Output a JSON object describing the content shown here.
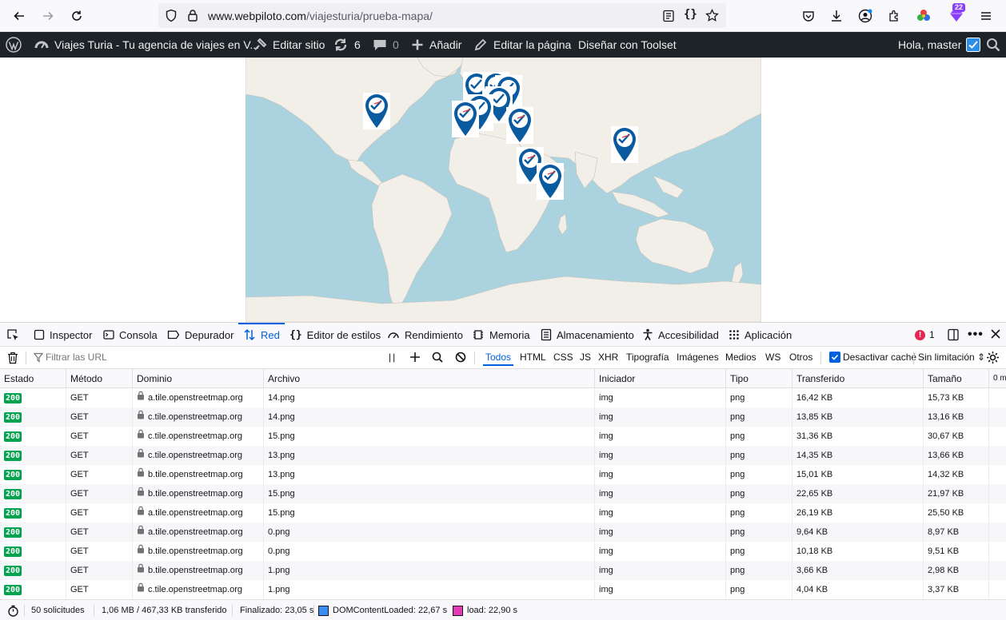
{
  "browser": {
    "url_host": "www.webpiloto.com",
    "url_path": "/viajesturia/prueba-mapa/",
    "extension_badge": "22"
  },
  "wp_admin_bar": {
    "site_name": "Viajes Turia - Tu agencia de viajes en V...",
    "edit_site": "Editar sitio",
    "updates_count": "6",
    "comments_count": "0",
    "add_new": "Añadir",
    "edit_page": "Editar la página",
    "toolset": "Diseñar con Toolset",
    "greeting": "Hola, master"
  },
  "devtools": {
    "tabs": [
      "Inspector",
      "Consola",
      "Depurador",
      "Red",
      "Editor de estilos",
      "Rendimiento",
      "Memoria",
      "Almacenamiento",
      "Accesibilidad",
      "Aplicación"
    ],
    "active_tab": "Red",
    "error_count": "1",
    "filter_placeholder": "Filtrar las URL",
    "type_filters": [
      "Todos",
      "HTML",
      "CSS",
      "JS",
      "XHR",
      "Tipografía",
      "Imágenes",
      "Medios",
      "WS",
      "Otros"
    ],
    "disable_cache": "Desactivar caché",
    "throttling": "Sin limitación",
    "columns": [
      "Estado",
      "Método",
      "Dominio",
      "Archivo",
      "Iniciador",
      "Tipo",
      "Transferido",
      "Tamaño",
      "0 m"
    ],
    "rows": [
      {
        "status": "200",
        "method": "GET",
        "domain": "a.tile.openstreetmap.org",
        "file": "14.png",
        "initiator": "img",
        "type": "png",
        "transferred": "16,42 KB",
        "size": "15,73 KB"
      },
      {
        "status": "200",
        "method": "GET",
        "domain": "c.tile.openstreetmap.org",
        "file": "14.png",
        "initiator": "img",
        "type": "png",
        "transferred": "13,85 KB",
        "size": "13,16 KB"
      },
      {
        "status": "200",
        "method": "GET",
        "domain": "c.tile.openstreetmap.org",
        "file": "15.png",
        "initiator": "img",
        "type": "png",
        "transferred": "31,36 KB",
        "size": "30,67 KB"
      },
      {
        "status": "200",
        "method": "GET",
        "domain": "c.tile.openstreetmap.org",
        "file": "13.png",
        "initiator": "img",
        "type": "png",
        "transferred": "14,35 KB",
        "size": "13,66 KB"
      },
      {
        "status": "200",
        "method": "GET",
        "domain": "b.tile.openstreetmap.org",
        "file": "13.png",
        "initiator": "img",
        "type": "png",
        "transferred": "15,01 KB",
        "size": "14,32 KB"
      },
      {
        "status": "200",
        "method": "GET",
        "domain": "b.tile.openstreetmap.org",
        "file": "15.png",
        "initiator": "img",
        "type": "png",
        "transferred": "22,65 KB",
        "size": "21,97 KB"
      },
      {
        "status": "200",
        "method": "GET",
        "domain": "a.tile.openstreetmap.org",
        "file": "15.png",
        "initiator": "img",
        "type": "png",
        "transferred": "26,19 KB",
        "size": "25,50 KB"
      },
      {
        "status": "200",
        "method": "GET",
        "domain": "a.tile.openstreetmap.org",
        "file": "0.png",
        "initiator": "img",
        "type": "png",
        "transferred": "9,64 KB",
        "size": "8,97 KB"
      },
      {
        "status": "200",
        "method": "GET",
        "domain": "b.tile.openstreetmap.org",
        "file": "0.png",
        "initiator": "img",
        "type": "png",
        "transferred": "10,18 KB",
        "size": "9,51 KB"
      },
      {
        "status": "200",
        "method": "GET",
        "domain": "b.tile.openstreetmap.org",
        "file": "1.png",
        "initiator": "img",
        "type": "png",
        "transferred": "3,66 KB",
        "size": "2,98 KB"
      },
      {
        "status": "200",
        "method": "GET",
        "domain": "c.tile.openstreetmap.org",
        "file": "1.png",
        "initiator": "img",
        "type": "png",
        "transferred": "4,04 KB",
        "size": "3,37 KB"
      }
    ],
    "status_bar": {
      "requests": "50 solicitudes",
      "transferred": "1,06 MB / 467,33 KB transferido",
      "finished": "Finalizado: 23,05 s",
      "dom_loaded": "DOMContentLoaded: 22,67 s",
      "load": "load: 22,90 s"
    }
  },
  "colors": {
    "accent": "#0061e0",
    "status_ok": "#00a44e",
    "map_water": "#aad3df",
    "map_land": "#f2efe9",
    "marker": "#0a5aa0",
    "dom_color": "#3b8ef0",
    "load_color": "#e23cb4"
  }
}
